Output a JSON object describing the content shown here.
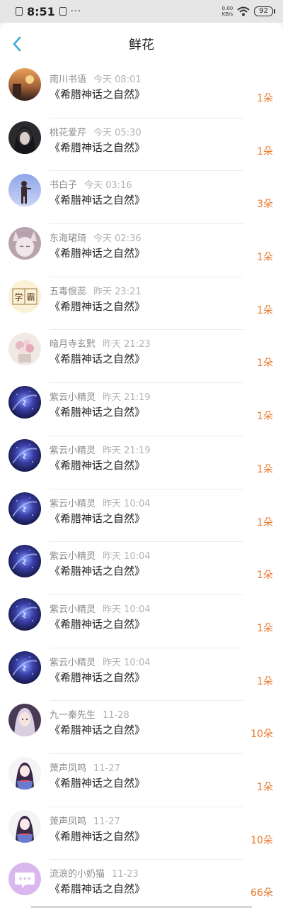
{
  "status_bar": {
    "time": "8:51",
    "more": "···",
    "speed_value": "0.00",
    "speed_unit": "KB/s",
    "battery": "92"
  },
  "header": {
    "title": "鲜花"
  },
  "colors": {
    "accent": "#3aa8d8",
    "count": "#e8792c"
  },
  "list": [
    {
      "name": "南川书语",
      "time": "今天 08:01",
      "book": "《希腊神话之自然》",
      "count": "1朵",
      "avatar": "sunset"
    },
    {
      "name": "桃花爱芹",
      "time": "今天 05:30",
      "book": "《希腊神话之自然》",
      "count": "1朵",
      "avatar": "dark-portrait"
    },
    {
      "name": "书白子",
      "time": "今天 03:16",
      "book": "《希腊神话之自然》",
      "count": "3朵",
      "avatar": "blue-figure"
    },
    {
      "name": "东海珺琦",
      "time": "今天 02:36",
      "book": "《希腊神话之自然》",
      "count": "1朵",
      "avatar": "anime-fox"
    },
    {
      "name": "五毒恨蕊",
      "time": "昨天 23:21",
      "book": "《希腊神话之自然》",
      "count": "1朵",
      "avatar": "xueba-text"
    },
    {
      "name": "暗月寺玄黓",
      "time": "昨天 21:23",
      "book": "《希腊神话之自然》",
      "count": "1朵",
      "avatar": "flowers"
    },
    {
      "name": "紫云小精灵",
      "time": "昨天 21:19",
      "book": "《希腊神话之自然》",
      "count": "1朵",
      "avatar": "galaxy"
    },
    {
      "name": "紫云小精灵",
      "time": "昨天 21:19",
      "book": "《希腊神话之自然》",
      "count": "1朵",
      "avatar": "galaxy"
    },
    {
      "name": "紫云小精灵",
      "time": "昨天 10:04",
      "book": "《希腊神话之自然》",
      "count": "1朵",
      "avatar": "galaxy"
    },
    {
      "name": "紫云小精灵",
      "time": "昨天 10:04",
      "book": "《希腊神话之自然》",
      "count": "1朵",
      "avatar": "galaxy"
    },
    {
      "name": "紫云小精灵",
      "time": "昨天 10:04",
      "book": "《希腊神话之自然》",
      "count": "1朵",
      "avatar": "galaxy"
    },
    {
      "name": "紫云小精灵",
      "time": "昨天 10:04",
      "book": "《希腊神话之自然》",
      "count": "1朵",
      "avatar": "galaxy"
    },
    {
      "name": "九一秦先生",
      "time": "11-28",
      "book": "《希腊神话之自然》",
      "count": "10朵",
      "avatar": "anime-girl-dark"
    },
    {
      "name": "萧声凤鸣",
      "time": "11-27",
      "book": "《希腊神话之自然》",
      "count": "1朵",
      "avatar": "anime-girl-hanfu"
    },
    {
      "name": "萧声凤鸣",
      "time": "11-27",
      "book": "《希腊神话之自然》",
      "count": "10朵",
      "avatar": "anime-girl-hanfu"
    },
    {
      "name": "流浪的小奶猫",
      "time": "11-23",
      "book": "《希腊神话之自然》",
      "count": "66朵",
      "avatar": "chat-bubble"
    }
  ]
}
